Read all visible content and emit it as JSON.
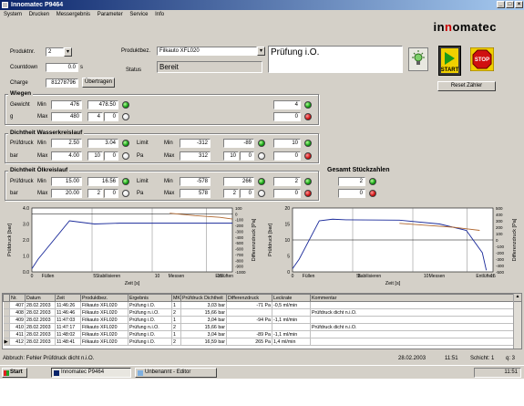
{
  "window": {
    "title": "Innomatec P9464"
  },
  "menu": [
    "System",
    "Drucken",
    "Messergebnis",
    "Parameter",
    "Service",
    "Info"
  ],
  "brand": {
    "pre": "in",
    "o": "n",
    "post": "omatec"
  },
  "top": {
    "produktnr_label": "Produktnr.",
    "produktnr_value": "2",
    "countdown_label": "Countdown",
    "countdown_value": "0.0",
    "countdown_unit": "s",
    "charge_label": "Charge",
    "charge_value": "81278796",
    "uebertragen_label": "Übertragen",
    "produktbez_label": "Produktbez.",
    "produktbez_value": "Filkauto XFL020",
    "status_label": "Status",
    "status_value": "Bereit",
    "result_text": "Prüfung i.O.",
    "start_label": "START",
    "stop_label": "STOP",
    "reset_label": "Reset Zähler"
  },
  "wiegen": {
    "title": "Wiegen",
    "gewicht_label": "Gewicht",
    "min_label": "Min",
    "min_value": "476",
    "actual": "478.50",
    "g_label": "g",
    "max_label": "Max",
    "max_value": "480",
    "count_a": "4",
    "count_b": "0",
    "total_ok": "4",
    "total_nok": "0"
  },
  "wasser": {
    "title": "Dichtheit Wasserkreislauf",
    "pruefdruck_label": "Prüfdruck",
    "min_label": "Min",
    "min_value": "2.50",
    "actual": "3.04",
    "bar_label": "bar",
    "max_label": "Max",
    "max_value": "4.00",
    "count_a": "10",
    "count_b": "0",
    "limit_label": "Limit",
    "lmin_label": "Min",
    "lmin_value": "-312",
    "lactual": "-89",
    "pa_label": "Pa",
    "lmax_label": "Max",
    "lmax_value": "312",
    "lcount_a": "10",
    "lcount_b": "0",
    "total_ok": "10",
    "total_nok": "0"
  },
  "oel": {
    "title": "Dichtheit Ölkreislauf",
    "pruefdruck_label": "Prüfdruck",
    "min_label": "Min",
    "min_value": "15.00",
    "actual": "16.56",
    "bar_label": "bar",
    "max_label": "Max",
    "max_value": "20.00",
    "count_a": "2",
    "count_b": "0",
    "limit_label": "Limit",
    "lmin_label": "Min",
    "lmin_value": "-578",
    "lactual": "266",
    "pa_label": "Pa",
    "lmax_label": "Max",
    "lmax_value": "578",
    "lcount_a": "2",
    "lcount_b": "0",
    "total_ok": "2",
    "total_nok": "0"
  },
  "gesamt": {
    "title": "Gesamt Stückzahlen",
    "ok": "2",
    "nok": "0"
  },
  "chart_data": [
    {
      "type": "line",
      "ylabel": "Prüfdruck [bar]",
      "y2label": "Differenzdruck [Pa]",
      "xlabel": "Zeit [s]",
      "ylim": [
        0,
        4
      ],
      "y2lim": [
        -1000,
        100
      ],
      "xlim": [
        0,
        16
      ],
      "yticks": [
        "0.0",
        "1.0",
        "2.0",
        "3.0",
        "4.0"
      ],
      "y2ticks": [
        "100",
        "0",
        "-100",
        "-200",
        "-300",
        "-400",
        "-500",
        "-600",
        "-700",
        "-800",
        "-900",
        "-1000"
      ],
      "xticks": [
        "0",
        "5",
        "10",
        "15"
      ],
      "phases": [
        "Füllen",
        "Stabilisieren",
        "Messen",
        "Entlüften"
      ],
      "series": [
        {
          "color": "#1a2a9a",
          "x": [
            0,
            0.5,
            3,
            5,
            7,
            9,
            12,
            14.5,
            15,
            16
          ],
          "y": [
            0.2,
            0.8,
            3.2,
            3.0,
            3.05,
            3.05,
            3.05,
            3.05,
            3.05,
            3.05
          ]
        },
        {
          "color": "#b06830",
          "x": [
            11,
            13,
            15,
            16
          ],
          "y2": [
            10,
            -30,
            -60,
            -89
          ]
        }
      ]
    },
    {
      "type": "line",
      "ylabel": "Prüfdruck [bar]",
      "y2label": "Differenzdruck [Pa]",
      "xlabel": "Zeit [s]",
      "ylim": [
        0,
        20
      ],
      "y2lim": [
        -500,
        500
      ],
      "xlim": [
        0,
        15
      ],
      "yticks": [
        "0",
        "5",
        "10",
        "15",
        "20"
      ],
      "y2ticks": [
        "500",
        "400",
        "300",
        "200",
        "100",
        "0",
        "-100",
        "-200",
        "-300",
        "-400",
        "-500"
      ],
      "xticks": [
        "0",
        "5",
        "10",
        "15"
      ],
      "phases": [
        "Füllen",
        "Stabilisieren",
        "Messen",
        "Entlüften"
      ],
      "series": [
        {
          "color": "#1a2a9a",
          "x": [
            0,
            0.5,
            2,
            3,
            4,
            8,
            11,
            13,
            14.2,
            14.5
          ],
          "y": [
            1,
            4,
            16,
            16.5,
            16.3,
            16.2,
            15.0,
            13.0,
            6,
            0.5
          ]
        },
        {
          "color": "#b06830",
          "x": [
            8,
            10,
            12,
            14
          ],
          "y2": [
            260,
            230,
            200,
            150
          ]
        }
      ]
    }
  ],
  "table": {
    "headers": [
      "",
      "Nr.",
      "Datum",
      "Zeit",
      "Produktbez.",
      "Ergebnis",
      "MK",
      "Prüfdruck Dichtheit",
      "Differenzdruck",
      "Leckrate",
      "Kommentar"
    ],
    "rows": [
      [
        "",
        "407",
        "28.02.2003",
        "11:46:26",
        "Filkauto XFL020",
        "Prüfung i.O.",
        "1",
        "3,03 bar",
        "-71 Pa",
        "-0,5 ml/min",
        ""
      ],
      [
        "",
        "408",
        "28.02.2003",
        "11:46:46",
        "Filkauto XFL020",
        "Prüfung n.i.O.",
        "2",
        "15,66 bar",
        "",
        "",
        "Prüfdruck dicht n.i.O."
      ],
      [
        "",
        "409",
        "28.02.2003",
        "11:47:03",
        "Filkauto XFL020",
        "Prüfung i.O.",
        "1",
        "3,04 bar",
        "-94 Pa",
        "-1,1 ml/min",
        ""
      ],
      [
        "",
        "410",
        "28.02.2003",
        "11:47:17",
        "Filkauto XFL020",
        "Prüfung n.i.O.",
        "2",
        "15,66 bar",
        "",
        "",
        "Prüfdruck dicht n.i.O."
      ],
      [
        "",
        "411",
        "28.02.2003",
        "11:48:02",
        "Filkauto XFL020",
        "Prüfung i.O.",
        "1",
        "3,04 bar",
        "-89 Pa",
        "-1,1 ml/min",
        ""
      ],
      [
        "▶",
        "412",
        "28.02.2003",
        "11:48:41",
        "Filkauto XFL020",
        "Prüfung i.O.",
        "2",
        "16,59 bar",
        "265 Pa",
        "1,4 ml/min",
        ""
      ]
    ]
  },
  "statusbar": {
    "message": "Abbruch: Fehler Prüfdruck dicht n.i.O.",
    "date": "28.02.2003",
    "time": "11:51",
    "shift": "Schicht: 1",
    "num": "q: 3"
  },
  "taskbar": {
    "start": "Start",
    "task1": "Innomatec P9464",
    "task2": "Unbenannt - Editor",
    "clock": "11:51"
  }
}
